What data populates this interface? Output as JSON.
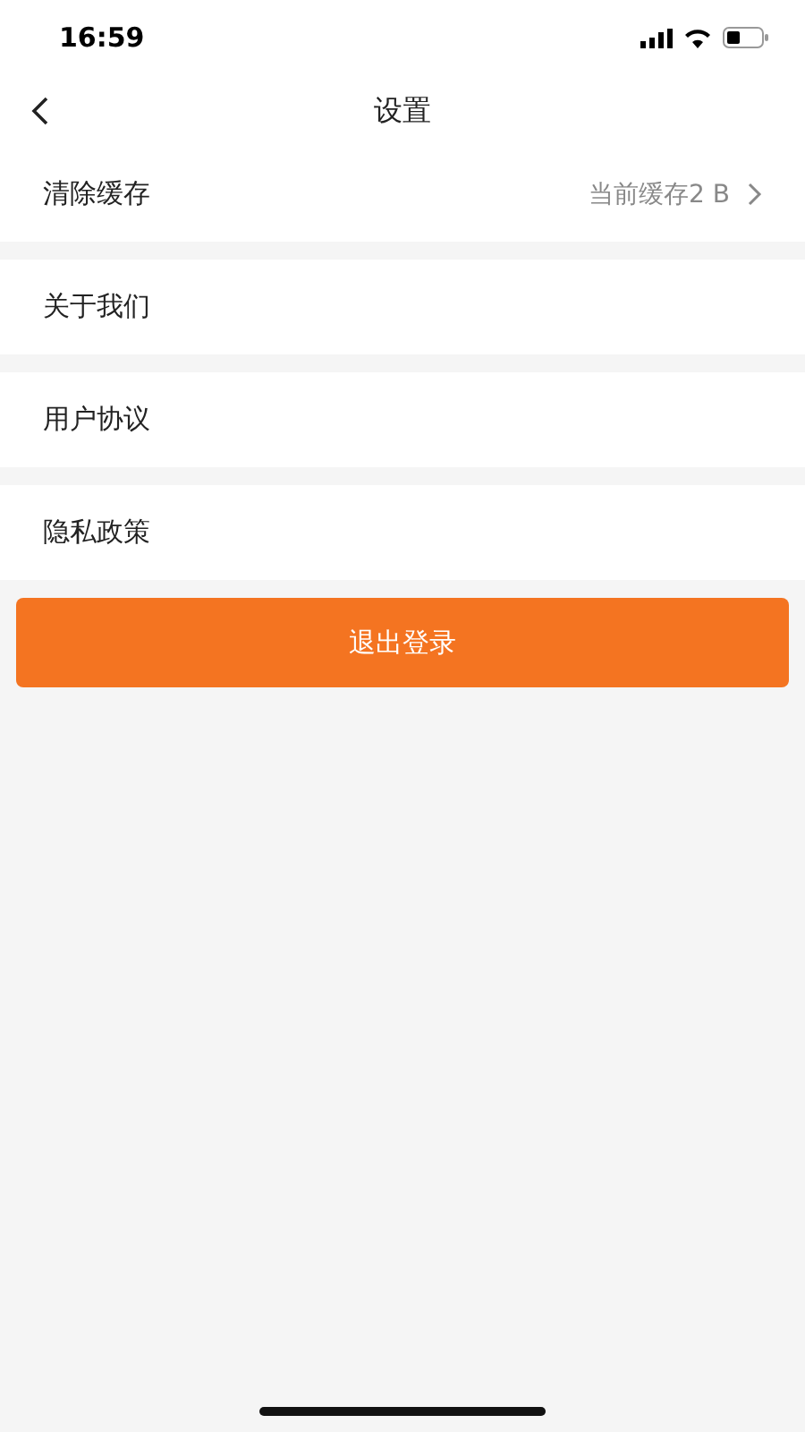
{
  "status_bar": {
    "time": "16:59"
  },
  "nav": {
    "title": "设置"
  },
  "items": [
    {
      "label": "清除缓存",
      "value": "当前缓存2 B",
      "arrow": true
    },
    {
      "label": "关于我们",
      "arrow": false
    },
    {
      "label": "用户协议",
      "arrow": false
    },
    {
      "label": "隐私政策",
      "arrow": false
    }
  ],
  "logout_button": "退出登录"
}
